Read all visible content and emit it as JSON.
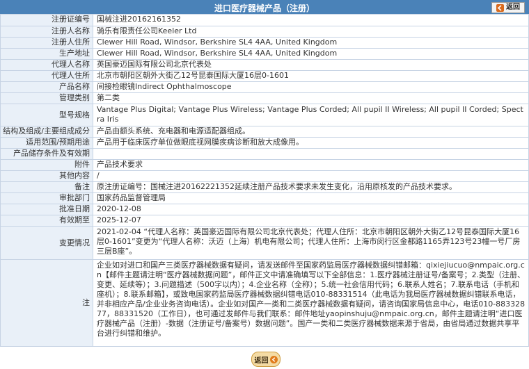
{
  "header": {
    "title": "进口医疗器械产品（注册）",
    "back_label": "返回"
  },
  "colors": {
    "header_bg": "#4a82b8",
    "label_bg": "#e9f0f8",
    "border": "#c6d3e4",
    "accent_orange": "#e07c1c"
  },
  "rows": [
    {
      "label": "注册证编号",
      "value": "国械注进20162161352"
    },
    {
      "label": "注册人名称",
      "value": "骑乐有限责任公司Keeler Ltd"
    },
    {
      "label": "注册人住所",
      "value": "Clewer Hill Road, Windsor, Berkshire SL4 4AA, United Kingdom"
    },
    {
      "label": "生产地址",
      "value": "Clewer Hill Road, Windsor, Berkshire SL4 4AA, United Kingdom"
    },
    {
      "label": "代理人名称",
      "value": "英国豪迈国际有限公司北京代表处"
    },
    {
      "label": "代理人住所",
      "value": "北京市朝阳区朝外大街乙12号昆泰国际大厦16层0-1601"
    },
    {
      "label": "产品名称",
      "value": "间接检眼镜Indirect Ophthalmoscope"
    },
    {
      "label": "管理类别",
      "value": "第二类"
    },
    {
      "label": "型号规格",
      "value": "Vantage Plus Digital; Vantage Plus Wireless; Vantage Plus Corded; All pupil II Wireless; All pupil II Corded; Spectra Iris"
    },
    {
      "label": "结构及组成/主要组成成分",
      "value": "产品由额头系统、充电器和电源适配器组成。"
    },
    {
      "label": "适用范围/预期用途",
      "value": "产品用于临床医疗单位做眼底视网膜疾病诊断和放大成像用。"
    },
    {
      "label": "产品储存条件及有效期",
      "value": ""
    },
    {
      "label": "附件",
      "value": "产品技术要求"
    },
    {
      "label": "其他内容",
      "value": "/"
    },
    {
      "label": "备注",
      "value": "原注册证编号：国械注进20162221352延续注册产品技术要求未发生变化，沿用原核发的产品技术要求。"
    },
    {
      "label": "审批部门",
      "value": "国家药品监督管理局"
    },
    {
      "label": "批准日期",
      "value": "2020-12-08"
    },
    {
      "label": "有效期至",
      "value": "2025-12-07"
    },
    {
      "label": "变更情况",
      "value": "2021-02-04 “代理人名称：英国豪迈国际有限公司北京代表处；代理人住所：北京市朝阳区朝外大街乙12号昆泰国际大厦16层0-1601”变更为“代理人名称：沃迈（上海）机电有限公司；代理人住所：上海市闵行区金都路1165弄123号23幢一号厂房三层B座”。"
    }
  ],
  "note": {
    "label": "注",
    "text": "企业如对进口和国产三类医疗器械数据有疑问，请发送邮件至国家药监局医疗器械数据纠错邮箱：qixiejiucuo@nmpaic.org.cn【邮件主题请注明“医疗器械数据问题”，邮件正文中请准确填写以下全部信息：1.医疗器械注册证号/备案号；2.类型（注册、变更、延续等）；3.问题描述（500字以内）；4.企业名称（全称）；5.统一社会信用代码；6.联系人姓名；7.联系电话（手机和座机）；8.联系邮箱】，或致电国家药监局医疗器械数据纠错电话010-88331514（此电话为我局医疗器械数据纠错联系电话，并非相应产品/企业业务咨询电话）。企业如对国产一类和二类医疗器械数据有疑问，请咨询国家局信息中心，电话010-88332877，88331520（工作日），也可通过发邮件与我们联系：邮件地址yaopinshuju@nmpaic.org.cn，邮件主题请注明“进口医疗器械产品（注册）-数据（注册证号/备案号）数据问题”。国产一类和二类医疗器械数据来源于省局，由省局通过数据共享平台进行纠错和维护。"
  },
  "footer": {
    "back_label": "返回"
  }
}
